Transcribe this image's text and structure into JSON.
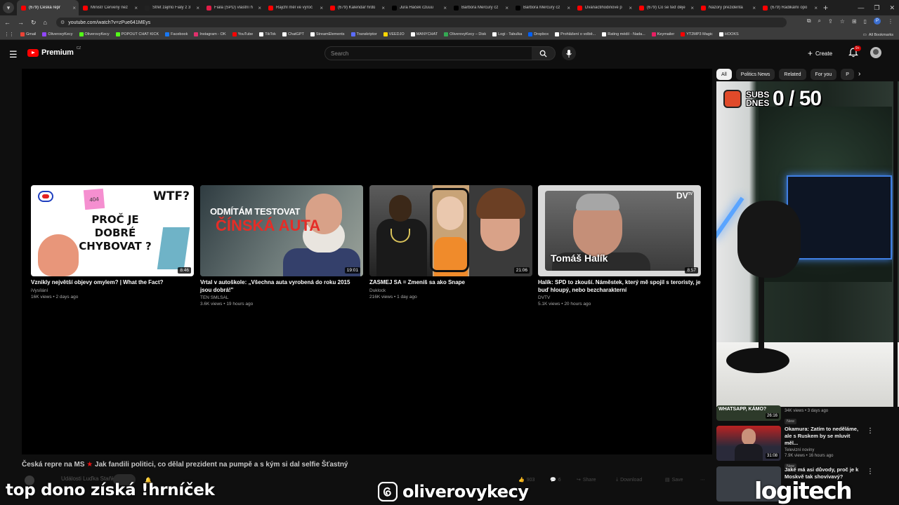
{
  "browser": {
    "tabs": [
      {
        "title": "(679) Česká repr",
        "color": "#ff0000",
        "active": true
      },
      {
        "title": "Ministr Červený nez",
        "color": "#ff0000"
      },
      {
        "title": "Střet zájmů Fialy z 3",
        "color": "#222222"
      },
      {
        "title": "Fiala (SPD) vlastní h",
        "color": "#e11d48"
      },
      {
        "title": "Rajchl měl ve výroč",
        "color": "#ff0000"
      },
      {
        "title": "(679) Kalendář hrdů",
        "color": "#ff0000"
      },
      {
        "title": "Jura Háček czuuu",
        "color": "#000000"
      },
      {
        "title": "Barbora Mercury cz",
        "color": "#000000"
      },
      {
        "title": "Barbora Mercury cz",
        "color": "#000000"
      },
      {
        "title": "Dvanáctihodinové p",
        "color": "#ff0000"
      },
      {
        "title": "(679) Co se teď děje",
        "color": "#ff0000"
      },
      {
        "title": "Názory prezidenta",
        "color": "#ff0000"
      },
      {
        "title": "(679) Radikální opo",
        "color": "#ff0000"
      }
    ],
    "url": "youtube.com/watch?v=zPue641MEys",
    "bookmarks": [
      {
        "label": "Gmail",
        "color": "#ea4335"
      },
      {
        "label": "OliverovyKecy",
        "color": "#9146ff"
      },
      {
        "label": "OliverovyKecy",
        "color": "#53fc18"
      },
      {
        "label": "POPOUT CHAT KICK",
        "color": "#53fc18"
      },
      {
        "label": "Facebook",
        "color": "#1877f2"
      },
      {
        "label": "Instagram - OK",
        "color": "#e1306c"
      },
      {
        "label": "YouTube",
        "color": "#ff0000"
      },
      {
        "label": "TikTok",
        "color": "#ffffff"
      },
      {
        "label": "ChatGPT",
        "color": "#ffffff"
      },
      {
        "label": "StreamElements",
        "color": "#ffffff"
      },
      {
        "label": "Transkriptor",
        "color": "#5b6cff"
      },
      {
        "label": "VEEDJO",
        "color": "#ffd700"
      },
      {
        "label": "MANYCHAT",
        "color": "#ffffff"
      },
      {
        "label": "OliverovyKecy – Disk",
        "color": "#34a853"
      },
      {
        "label": "Logi - Tabulka",
        "color": "#ffffff"
      },
      {
        "label": "Dropbox",
        "color": "#0061ff"
      },
      {
        "label": "Prohlášení o volbě...",
        "color": "#ffffff"
      },
      {
        "label": "Rating médií - Nada...",
        "color": "#ffffff"
      },
      {
        "label": "Keymailer",
        "color": "#e91e63"
      },
      {
        "label": "YT2MP3 Magic",
        "color": "#ff0000"
      },
      {
        "label": "HOOKS",
        "color": "#ffffff"
      }
    ],
    "all_bookmarks": "All Bookmarks"
  },
  "yt": {
    "brand": "Premium",
    "country": "CZ",
    "search_placeholder": "Search",
    "create": "Create",
    "notif_count": "9+"
  },
  "end_cards": [
    {
      "title": "Vznikly největší objevy omylem? | What the Fact?",
      "channel": "iVysílání",
      "meta": "16K views • 2 days ago",
      "duration": "8:46",
      "thumb": {
        "wtf": "WTF?",
        "note": "404",
        "main": "PROČ JE DOBRÉ CHYBOVAT ?"
      }
    },
    {
      "title": "Vrtal v autoškole: „Všechna auta vyrobená do roku 2015 jsou dobrá!\"",
      "channel": "TEN SMLSAL",
      "meta": "3.6K views • 19 hours ago",
      "duration": "19:01",
      "thumb": {
        "line1": "ODMÍTÁM TESTOVAT",
        "line2": "ČÍNSKÁ AUTA"
      }
    },
    {
      "title": "ZASMEJ SA = Zmeníš sa ako Snape",
      "channel": "Duklock",
      "meta": "216K views • 1 day ago",
      "duration": "21:06"
    },
    {
      "title": "Halík: SPD to zkouší. Náměstek, který mě spojil s teroristy, je buď hloupý, nebo bezcharakterní",
      "channel": "DVTV",
      "meta": "5.1K views • 20 hours ago",
      "duration": "8:57",
      "thumb": {
        "logo": "DV",
        "logo_sup": "TV",
        "name": "Tomáš Halík"
      }
    }
  ],
  "video": {
    "title": "Česká repre na MS",
    "title_suffix": "Jak fandili politici, co dělal prezident na pumpě a s kým si dal selfie Šťastný",
    "channel": "Události Luďka Staňka",
    "likes": "903",
    "comments": "6",
    "share": "Share",
    "download": "Download",
    "save": "Save"
  },
  "overlays": {
    "left": "top dono získá !hrníček",
    "mid": "oliverovykecy",
    "right": "logitech"
  },
  "sidebar": {
    "chips": [
      "All",
      "Politics News",
      "Related",
      "For you",
      "P"
    ],
    "webcam_counter_label": "SUBS DNES",
    "webcam_counter": "0 / 50",
    "recs": [
      {
        "title": "",
        "channel": "",
        "meta": "34K views • 3 days ago",
        "badge": "New",
        "duration": "26:16",
        "thumb_text": "WHATSAPP, KÁMO?"
      },
      {
        "title": "Okamura: Zatím to neděláme, ale s Ruskem by se mluvit měl...",
        "channel": "Televizní noviny",
        "meta": "7.9K views • 16 hours ago",
        "badge": "New",
        "duration": "31:08"
      },
      {
        "title": "Jaké má asi důvody, proč je k Moskvě tak shovívavý?",
        "channel": "",
        "meta": "",
        "badge": "",
        "duration": ""
      }
    ]
  }
}
